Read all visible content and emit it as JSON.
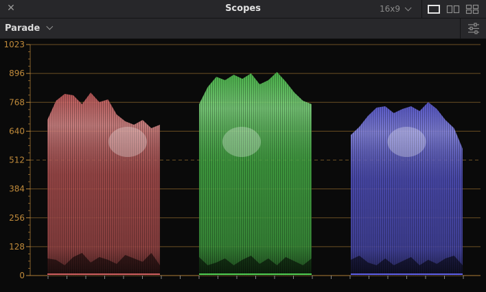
{
  "window": {
    "title": "Scopes",
    "aspect": "16x9"
  },
  "toolbar": {
    "scope_type": "Parade"
  },
  "scope": {
    "axis_labels": [
      "0",
      "128",
      "256",
      "384",
      "512",
      "640",
      "768",
      "896",
      "1023"
    ],
    "axis_color": "#c08a3a",
    "channels": [
      {
        "id": "red",
        "color": "#e86a6a"
      },
      {
        "id": "green",
        "color": "#5ce65c"
      },
      {
        "id": "blue",
        "color": "#6b6bff"
      }
    ]
  }
}
